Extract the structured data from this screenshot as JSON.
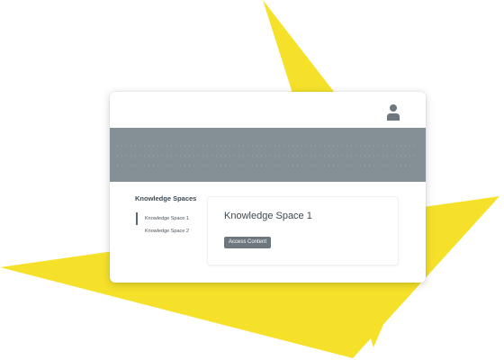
{
  "colors": {
    "accent_yellow": "#f5e12a",
    "banner_gray": "#858f96",
    "button_gray": "#6e777e",
    "text_dark": "#3f4a52"
  },
  "header": {
    "user_icon": "user-icon"
  },
  "sidebar": {
    "title": "Knowledge Spaces",
    "items": [
      {
        "label": "Knowledge Space 1",
        "active": true
      },
      {
        "label": "Knowledge Space 2",
        "active": false
      }
    ]
  },
  "main": {
    "card": {
      "title": "Knowledge Space 1",
      "button_label": "Access Content"
    }
  }
}
